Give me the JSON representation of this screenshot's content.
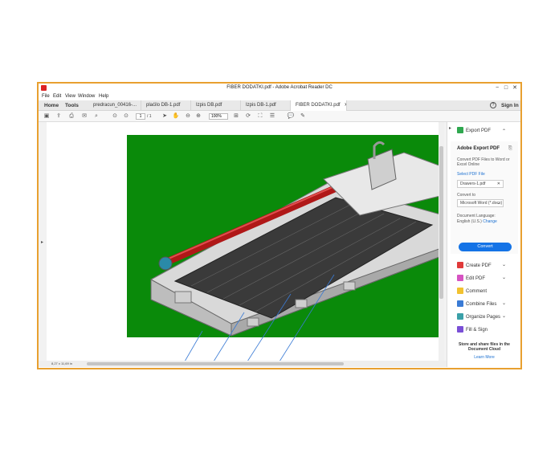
{
  "window": {
    "title": "FIBER DODATKI.pdf - Adobe Acrobat Reader DC",
    "controls": {
      "minimize": "−",
      "maximize": "□",
      "close": "✕"
    }
  },
  "menu": [
    "File",
    "Edit",
    "View",
    "Window",
    "Help"
  ],
  "nav": {
    "home": "Home",
    "tools": "Tools",
    "signin": "Sign In",
    "help": "?"
  },
  "tabs": [
    {
      "label": "predracun_00416-...",
      "active": false
    },
    {
      "label": "plaćilo DB-1.pdf",
      "active": false
    },
    {
      "label": "Izpis DB.pdf",
      "active": false
    },
    {
      "label": "Izpis DB-1.pdf",
      "active": false
    },
    {
      "label": "FIBER DODATKI.pdf",
      "active": true
    }
  ],
  "toolbar": {
    "page_current": "1",
    "page_total": "/ 1",
    "zoom": "100%"
  },
  "document": {
    "page_size": "8,27 x 11,69 in"
  },
  "right_panel": {
    "export_title": "Export PDF",
    "adobe_export": "Adobe Export PDF",
    "description": "Convert PDF Files to Word or Excel Online",
    "select_file": "Select PDF File",
    "file_name": "Drawers-1.pdf",
    "convert_to_label": "Convert to",
    "convert_to_value": "Microsoft Word (*.docx)",
    "doc_language_label": "Document Language:",
    "doc_language_value": "English (U.S.)",
    "change": "Change",
    "convert_button": "Convert",
    "tools": [
      {
        "label": "Create PDF",
        "icon": "create-pdf-icon",
        "color": "#e03a3a",
        "chevron": true
      },
      {
        "label": "Edit PDF",
        "icon": "edit-pdf-icon",
        "color": "#d653c2",
        "chevron": true
      },
      {
        "label": "Comment",
        "icon": "comment-icon",
        "color": "#f2c230",
        "chevron": false
      },
      {
        "label": "Combine Files",
        "icon": "combine-files-icon",
        "color": "#3a7bd5",
        "chevron": true
      },
      {
        "label": "Organize Pages",
        "icon": "organize-pages-icon",
        "color": "#3aa0a8",
        "chevron": true
      },
      {
        "label": "Fill & Sign",
        "icon": "fill-sign-icon",
        "color": "#7a4fd6",
        "chevron": false
      }
    ],
    "share_text": "Store and share files in the Document Cloud",
    "learn_more": "Learn More"
  },
  "colors": {
    "accent": "#1473e6",
    "window_border": "#e8a030",
    "image_bg": "#0a8a0a"
  }
}
